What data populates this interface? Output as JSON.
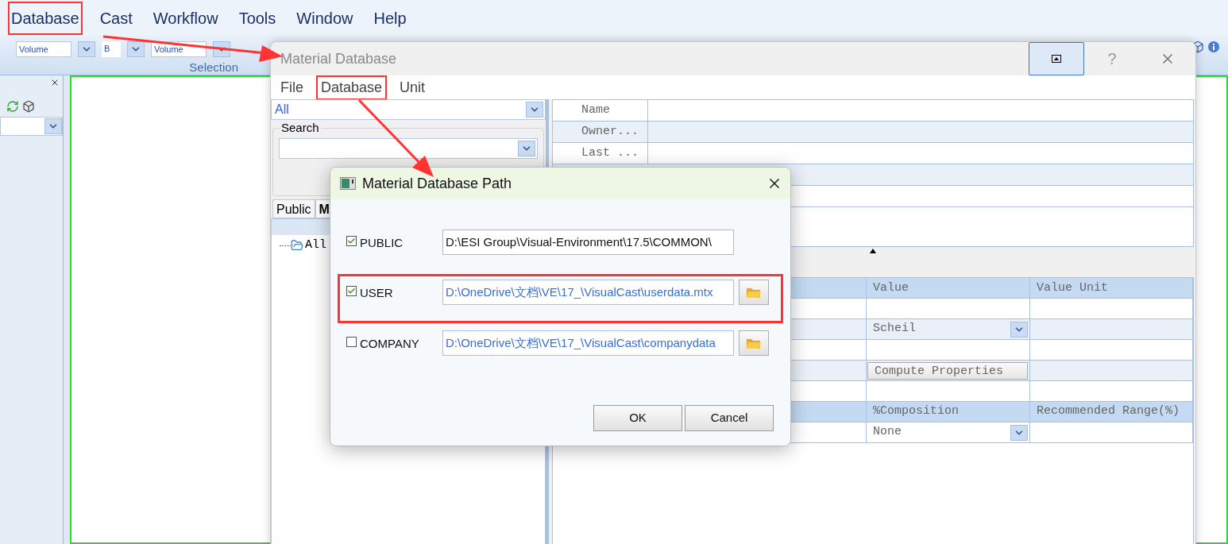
{
  "menu_bar": [
    {
      "label": "Database",
      "annotated": true
    },
    {
      "label": "Cast",
      "annotated": false
    },
    {
      "label": "Workflow",
      "annotated": false
    },
    {
      "label": "Tools",
      "annotated": false
    },
    {
      "label": "Window",
      "annotated": false
    },
    {
      "label": "Help",
      "annotated": false
    }
  ],
  "toolbar": {
    "field_1": "Volume",
    "field_2": "B",
    "field_3": "Volume",
    "group_label": "Selection"
  },
  "material_database": {
    "title": "Material Database",
    "help_button": "?",
    "menu": [
      {
        "label": "File",
        "annotated": false
      },
      {
        "label": "Database",
        "annotated": true
      },
      {
        "label": "Unit",
        "annotated": false
      }
    ],
    "filter": "All",
    "search_label": "Search",
    "tabs": [
      {
        "label": "Public",
        "selected": false
      },
      {
        "label": "M",
        "selected": true
      }
    ],
    "tree": [
      {
        "label": "All"
      }
    ],
    "properties": [
      "Name",
      "Owner...",
      "Last ..."
    ],
    "lower_table": {
      "columns": [
        "Value",
        "Value Unit"
      ],
      "rows": [
        {
          "kind": "blank"
        },
        {
          "kind": "dropdown",
          "value": "Scheil"
        },
        {
          "kind": "blank"
        },
        {
          "kind": "button",
          "label": "Compute Properties"
        },
        {
          "kind": "blank"
        },
        {
          "kind": "header",
          "cells": [
            "%Composition",
            "Recommended Range(%)"
          ]
        },
        {
          "kind": "dropdown",
          "value": "None"
        }
      ]
    }
  },
  "dialog": {
    "title": "Material Database Path",
    "paths": [
      {
        "label": "PUBLIC",
        "checked": true,
        "path": "D:\\ESI Group\\Visual-Environment\\17.5\\COMMON\\",
        "browse": false,
        "annotated": false
      },
      {
        "label": "USER",
        "checked": true,
        "path": "D:\\OneDrive\\文档\\VE\\17_\\VisualCast\\userdata.mtx",
        "browse": true,
        "annotated": true
      },
      {
        "label": "COMPANY",
        "checked": false,
        "path": "D:\\OneDrive\\文档\\VE\\17_\\VisualCast\\companydata",
        "browse": true,
        "annotated": false
      }
    ],
    "buttons": [
      "OK",
      "Cancel"
    ]
  }
}
